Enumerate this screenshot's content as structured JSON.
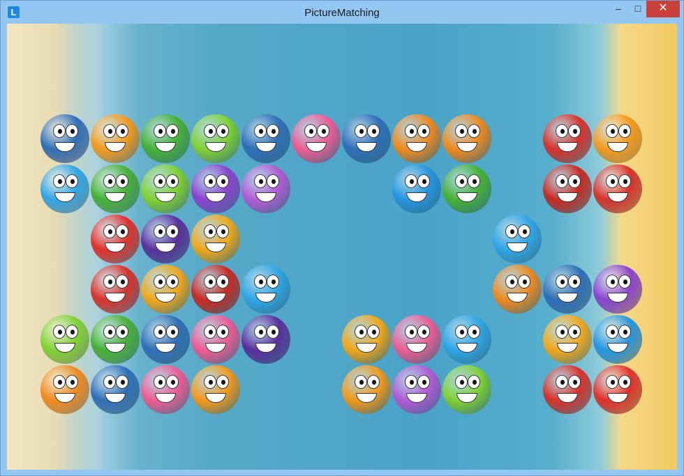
{
  "window": {
    "title": "PictureMatching",
    "icon_letter": "L",
    "controls": {
      "minimize": "–",
      "maximize": "□",
      "close": "✕"
    }
  },
  "tile_types": {
    "whale": {
      "icon": "whale-icon",
      "color": "#2f6fb8"
    },
    "orange-fish": {
      "icon": "orange-fish-icon",
      "color": "#f39a1c"
    },
    "green-frog": {
      "icon": "green-frog-icon",
      "color": "#45b236"
    },
    "green-ball": {
      "icon": "green-ball-icon",
      "color": "#7fd132"
    },
    "pink-puffer": {
      "icon": "pink-puffer-icon",
      "color": "#ef5c95"
    },
    "orange-dizzy": {
      "icon": "orange-dizzy-icon",
      "color": "#f08a1e"
    },
    "red-shrimp": {
      "icon": "red-shrimp-icon",
      "color": "#d9322b"
    },
    "blue-dolphin": {
      "icon": "blue-dolphin-icon",
      "color": "#2fa6e6"
    },
    "purple-blob": {
      "icon": "purple-blob-icon",
      "color": "#8b44d0"
    },
    "purple-jellyfish": {
      "icon": "purple-jellyfish-icon",
      "color": "#b35bd6"
    },
    "blue-squid": {
      "icon": "blue-squid-icon",
      "color": "#2596e0"
    },
    "red-octopus": {
      "icon": "red-octopus-icon",
      "color": "#e3312a"
    },
    "purple-monster": {
      "icon": "purple-monster-icon",
      "color": "#5b2fa0"
    },
    "yellow-snail": {
      "icon": "yellow-snail-icon",
      "color": "#f2a81a"
    },
    "red-crab": {
      "icon": "red-crab-icon",
      "color": "#c92a22"
    }
  },
  "board": {
    "rows": [
      [
        "whale",
        "orange-fish",
        "green-frog",
        "green-ball",
        "whale",
        "pink-puffer",
        "whale",
        "orange-dizzy",
        "orange-dizzy",
        null,
        "red-shrimp",
        "orange-fish"
      ],
      [
        "blue-dolphin",
        "green-frog",
        "green-ball",
        "purple-blob",
        "purple-jellyfish",
        null,
        null,
        "blue-squid",
        "green-frog",
        null,
        "red-crab",
        "red-shrimp"
      ],
      [
        null,
        "red-octopus",
        "purple-monster",
        "yellow-snail",
        null,
        null,
        null,
        null,
        null,
        "blue-dolphin",
        null,
        null
      ],
      [
        null,
        "red-shrimp",
        "yellow-snail",
        "red-crab",
        "blue-dolphin",
        null,
        null,
        null,
        null,
        "orange-dizzy",
        "whale",
        "purple-blob"
      ],
      [
        "green-ball",
        "green-frog",
        "whale",
        "pink-puffer",
        "purple-monster",
        null,
        "yellow-snail",
        "pink-puffer",
        "blue-dolphin",
        null,
        "yellow-snail",
        "blue-squid"
      ],
      [
        "orange-dizzy",
        "whale",
        "pink-puffer",
        "orange-fish",
        null,
        null,
        "orange-fish",
        "purple-jellyfish",
        "green-ball",
        null,
        "red-shrimp",
        "red-octopus"
      ]
    ]
  }
}
